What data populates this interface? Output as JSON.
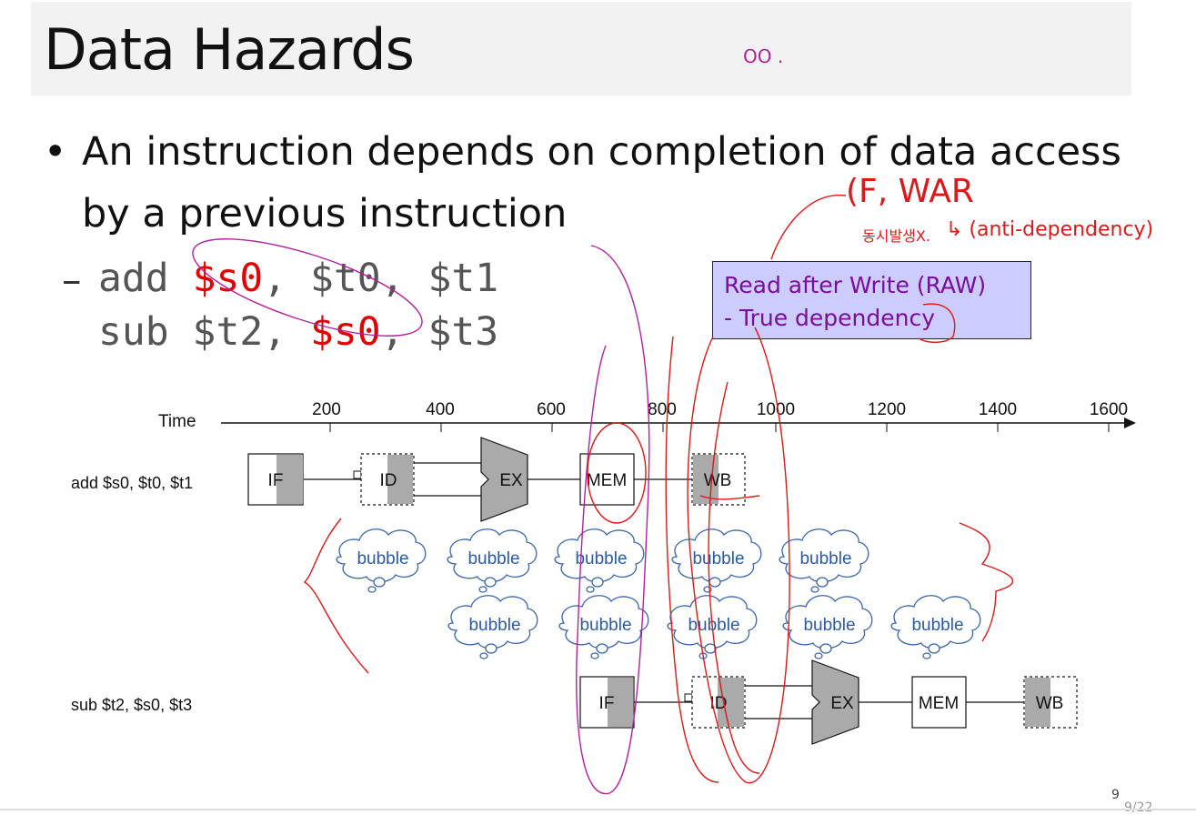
{
  "slide": {
    "title": "Data Hazards",
    "bullet_symbol": "•",
    "bullet_line1": "An instruction depends on completion of data access",
    "bullet_line2": "by a previous instruction",
    "dash": "–",
    "code_line1": {
      "op": "add ",
      "reg_red": "$s0",
      "rest": ", $t0, $t1"
    },
    "code_line2": {
      "op": "sub $t2, ",
      "reg_red": "$s0",
      "rest": ", $t3"
    },
    "callout_line1": "Read after Write (RAW)",
    "callout_line2": "- True dependency",
    "page_number": "9",
    "page_indicator": "9/22"
  },
  "annotations": {
    "top_mark": "OO .",
    "war": "(F, WAR",
    "korean_note": "동시발생X.",
    "antidep": "↳ (anti-dependency)"
  },
  "diagram": {
    "time_label": "Time",
    "ticks": [
      "200",
      "400",
      "600",
      "800",
      "1000",
      "1200",
      "1400",
      "1600"
    ],
    "instr1_label": "add $s0, $t0, $t1",
    "instr2_label": "sub $t2, $s0, $t3",
    "stages": {
      "if": "IF",
      "id": "ID",
      "ex": "EX",
      "mem": "MEM",
      "wb": "WB"
    },
    "bubble_text": "bubble",
    "bubble_rows": [
      5,
      5
    ]
  }
}
